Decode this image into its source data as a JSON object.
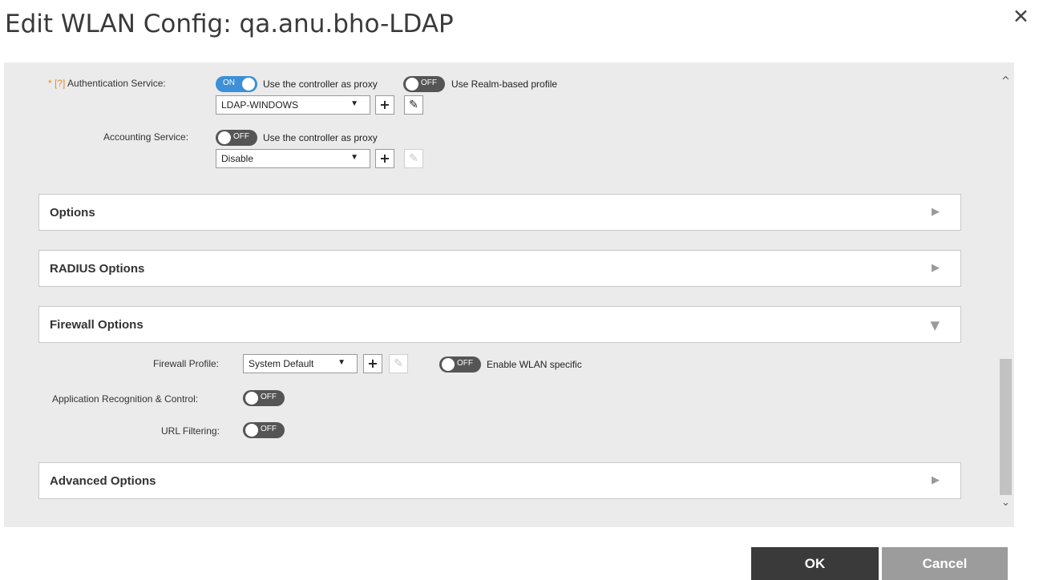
{
  "dialog": {
    "title": "Edit WLAN Config: qa.anu.bho-LDAP",
    "close_glyph": "✕"
  },
  "auth": {
    "required_marker": "* [?]",
    "label": "Authentication Service:",
    "proxy_toggle": "ON",
    "proxy_label": "Use the controller as proxy",
    "realm_toggle": "OFF",
    "realm_label": "Use Realm-based profile",
    "selected": "LDAP-WINDOWS"
  },
  "accounting": {
    "label": "Accounting Service:",
    "proxy_toggle": "OFF",
    "proxy_label": "Use the controller as proxy",
    "selected": "Disable"
  },
  "panels": {
    "options": "Options",
    "radius": "RADIUS Options",
    "firewall": "Firewall Options",
    "advanced": "Advanced Options"
  },
  "firewall": {
    "profile_label": "Firewall Profile:",
    "profile_selected": "System Default",
    "wlan_toggle": "OFF",
    "wlan_label": "Enable WLAN specific",
    "app_label": "Application Recognition & Control:",
    "app_toggle": "OFF",
    "url_label": "URL Filtering:",
    "url_toggle": "OFF"
  },
  "icons": {
    "plus": "+",
    "edit": "✎",
    "select_arrow": "▼",
    "collapsed_arrow": "▶",
    "expanded_arrow": "▼",
    "scroll_up": "^",
    "scroll_down": "⌄"
  },
  "buttons": {
    "ok": "OK",
    "cancel": "Cancel"
  },
  "colors": {
    "toggle_on": "#3d8fd6",
    "toggle_off": "#555555",
    "required": "#e98a2b",
    "ok_button": "#3a3a3a",
    "cancel_button": "#9c9c9c"
  }
}
